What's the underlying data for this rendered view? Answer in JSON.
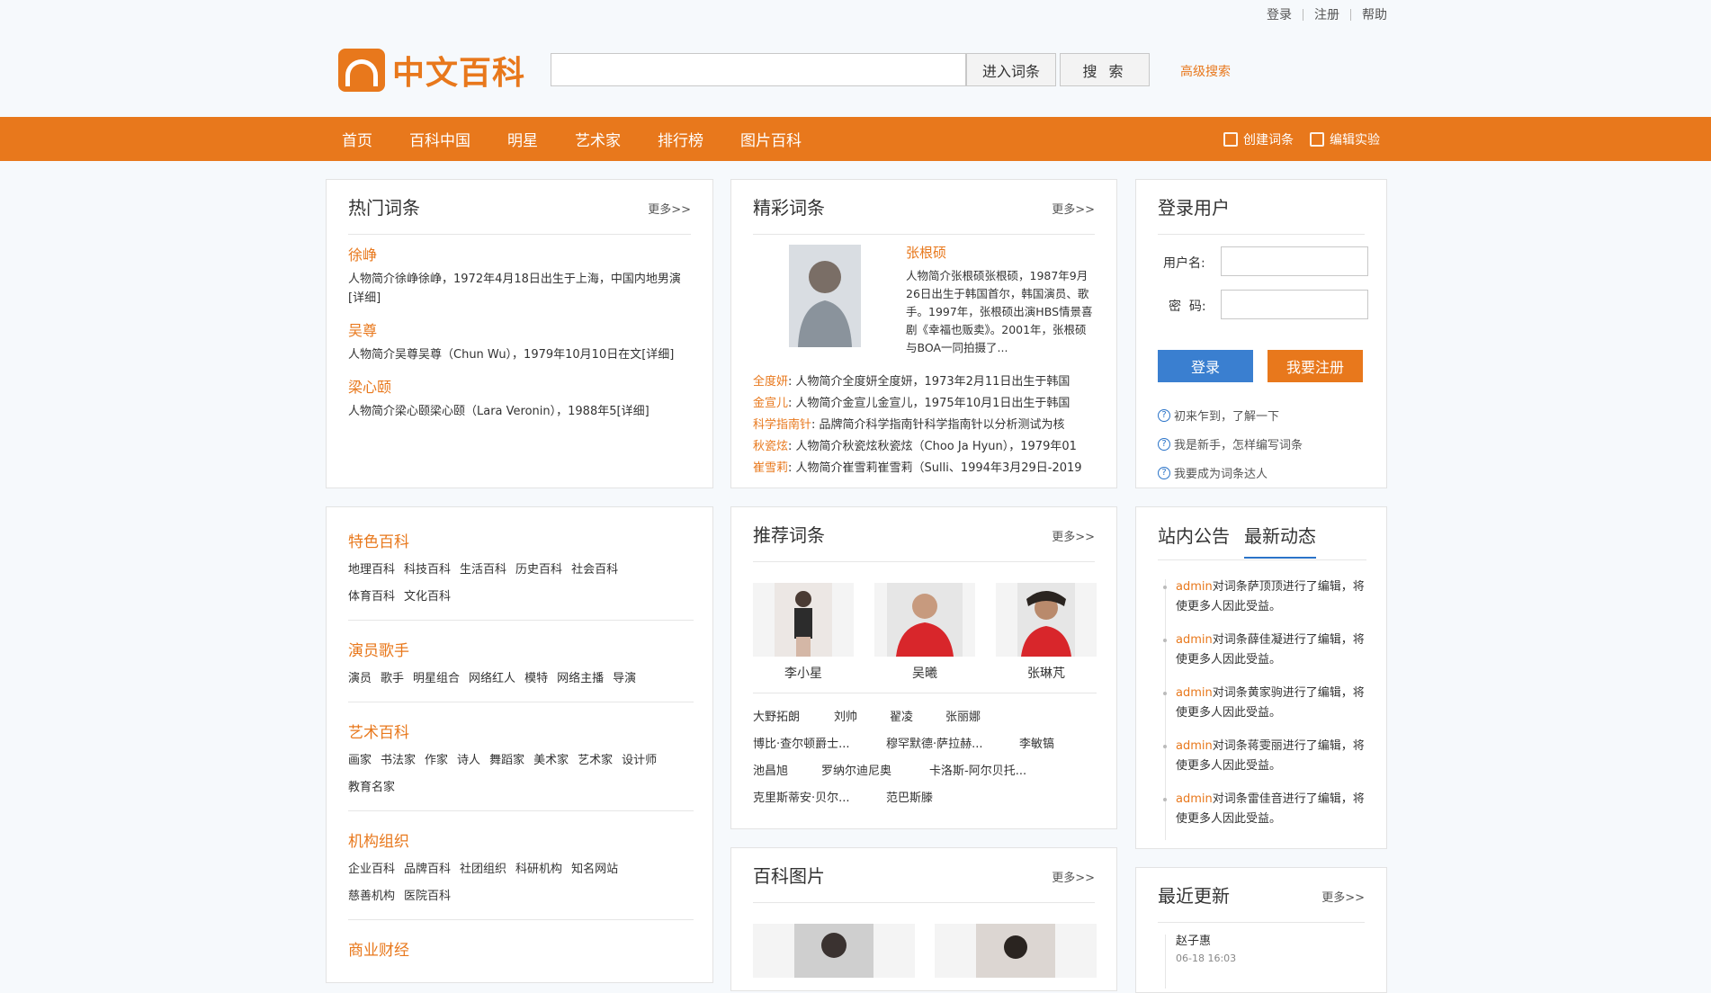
{
  "toplinks": [
    "登录",
    "注册",
    "帮助"
  ],
  "logo_text": "中文百科",
  "search": {
    "enter_label": "进入词条",
    "search_label": "搜 索",
    "advanced": "高级搜索"
  },
  "nav": {
    "items": [
      "首页",
      "百科中国",
      "明星",
      "艺术家",
      "排行榜",
      "图片百科"
    ],
    "create": "创建词条",
    "edit": "编辑实验"
  },
  "hot": {
    "title": "热门词条",
    "more": "更多>>",
    "entries": [
      {
        "name": "徐峥",
        "desc": "人物简介徐峥徐峥，1972年4月18日出生于上海，中国内地男演[详细]"
      },
      {
        "name": "吴尊",
        "desc": "人物简介吴尊吴尊（Chun Wu），1979年10月10日在文[详细]"
      },
      {
        "name": "梁心颐",
        "desc": "人物简介梁心颐梁心颐（Lara Veronin），1988年5[详细]"
      }
    ]
  },
  "featured": {
    "title": "精彩词条",
    "more": "更多>>",
    "main_name": "张根硕",
    "main_desc": "人物简介张根硕张根硕，1987年9月26日出生于韩国首尔，韩国演员、歌手。1997年，张根硕出演HBS情景喜剧《幸福也贩卖》。2001年，张根硕与BOA一同拍摄了...",
    "lines": [
      {
        "k": "全度妍",
        "t": ": 人物简介全度妍全度妍，1973年2月11日出生于韩国"
      },
      {
        "k": "金宣儿",
        "t": ": 人物简介金宣儿金宣儿，1975年10月1日出生于韩国"
      },
      {
        "k": "科学指南针",
        "t": ": 品牌简介科学指南针科学指南针以分析测试为核"
      },
      {
        "k": "秋瓷炫",
        "t": ": 人物简介秋瓷炫秋瓷炫（Choo Ja Hyun），1979年01"
      },
      {
        "k": "崔雪莉",
        "t": ": 人物简介崔雪莉崔雪莉（Sulli、1994年3月29日-2019"
      }
    ]
  },
  "login": {
    "title": "登录用户",
    "username_label": "用户名:",
    "password_label": "密  码:",
    "login_btn": "登录",
    "register_btn": "我要注册",
    "help": [
      "初来乍到，了解一下",
      "我是新手，怎样编写词条",
      "我要成为词条达人"
    ]
  },
  "categories": [
    {
      "title": "特色百科",
      "items": [
        "地理百科",
        "科技百科",
        "生活百科",
        "历史百科",
        "社会百科",
        "体育百科",
        "文化百科"
      ]
    },
    {
      "title": "演员歌手",
      "items": [
        "演员",
        "歌手",
        "明星组合",
        "网络红人",
        "模特",
        "网络主播",
        "导演"
      ]
    },
    {
      "title": "艺术百科",
      "items": [
        "画家",
        "书法家",
        "作家",
        "诗人",
        "舞蹈家",
        "美术家",
        "艺术家",
        "设计师",
        "教育名家"
      ]
    },
    {
      "title": "机构组织",
      "items": [
        "企业百科",
        "品牌百科",
        "社团组织",
        "科研机构",
        "知名网站",
        "慈善机构",
        "医院百科"
      ]
    },
    {
      "title": "商业财经",
      "items": []
    }
  ],
  "recommend": {
    "title": "推荐词条",
    "more": "更多>>",
    "people": [
      "李小星",
      "吴曦",
      "张琳芃"
    ],
    "rows": [
      [
        "大野拓朗",
        "刘帅",
        "翟凌",
        "张丽娜"
      ],
      [
        "博比·查尔顿爵士...",
        "穆罕默德·萨拉赫...",
        "李敏镐"
      ],
      [
        "池昌旭",
        "罗纳尔迪尼奥",
        "卡洛斯-阿尔贝托..."
      ],
      [
        "克里斯蒂安·贝尔...",
        "范巴斯滕"
      ]
    ]
  },
  "news": {
    "tab1": "站内公告",
    "tab2": "最新动态",
    "items": [
      {
        "user": "admin",
        "text": "对词条萨顶顶进行了编辑，将使更多人因此受益。"
      },
      {
        "user": "admin",
        "text": "对词条薛佳凝进行了编辑，将使更多人因此受益。"
      },
      {
        "user": "admin",
        "text": "对词条黄家驹进行了编辑，将使更多人因此受益。"
      },
      {
        "user": "admin",
        "text": "对词条蒋雯丽进行了编辑，将使更多人因此受益。"
      },
      {
        "user": "admin",
        "text": "对词条雷佳音进行了编辑，将使更多人因此受益。"
      }
    ]
  },
  "images": {
    "title": "百科图片",
    "more": "更多>>"
  },
  "recent": {
    "title": "最近更新",
    "more": "更多>>",
    "items": [
      {
        "name": "赵子惠",
        "time": "06-18 16:03"
      }
    ]
  }
}
